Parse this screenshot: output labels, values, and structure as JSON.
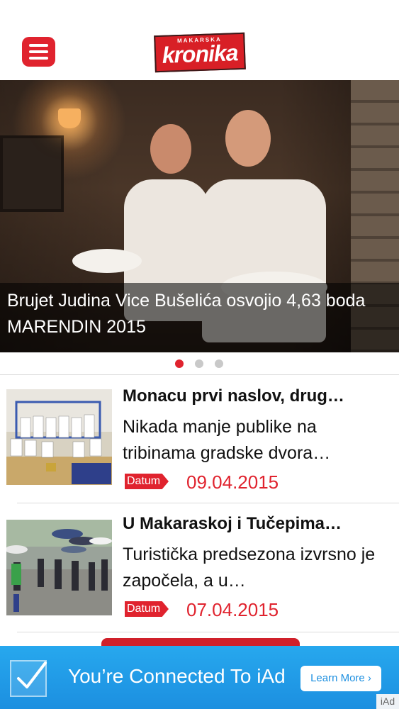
{
  "header": {
    "menu_icon": "hamburger-icon",
    "logo": {
      "small": "MAKARSKA",
      "big": "kronika"
    }
  },
  "hero": {
    "caption": "Brujet Judina Vice Bušelića osvojio 4,63 boda MARENDIN 2015",
    "page_indicator": {
      "count": 3,
      "active": 1
    }
  },
  "articles": [
    {
      "title": "Monacu prvi naslov, drug…",
      "summary": "Nikada manje publike na tribinama gradske dvora…",
      "date_label": "Datum",
      "date": "09.04.2015"
    },
    {
      "title": "U Makaraskoj i Tučepima…",
      "summary": "Turistička predsezona izvrsno je započela, a u…",
      "date_label": "Datum",
      "date": "07.04.2015"
    }
  ],
  "ad_banner": {
    "message": "You’re Connected To iAd",
    "button": "Learn More ›",
    "badge": "iAd",
    "check_icon": "checkmark-icon"
  },
  "colors": {
    "accent": "#e0232e",
    "ad": "#1c8fe0"
  }
}
